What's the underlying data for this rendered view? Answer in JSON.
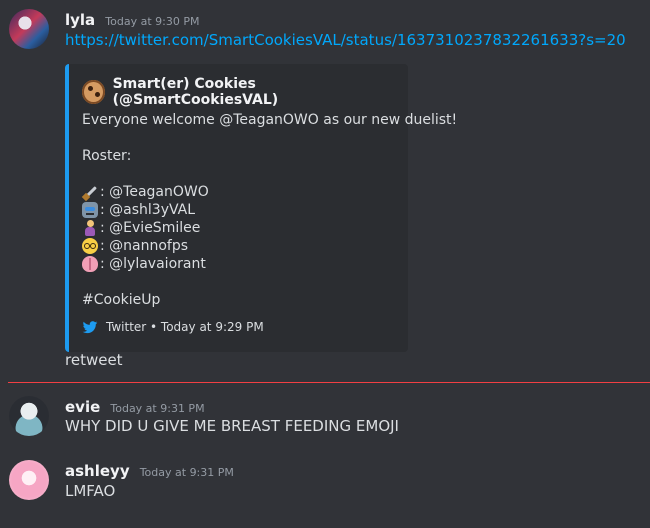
{
  "messages": [
    {
      "username": "lyla",
      "timestamp": "Today at 9:30 PM",
      "link": "https://twitter.com/SmartCookiesVAL/status/1637310237832261633?s=20",
      "embed": {
        "author": "Smart(er) Cookies (@SmartCookiesVAL)",
        "line1": "Everyone welcome @TeaganOWO as our new duelist!",
        "roster_heading": "Roster:",
        "roster": [
          {
            "icon": "dagger-emoji",
            "text": ": @TeaganOWO"
          },
          {
            "icon": "robot-emoji",
            "text": ": @ashl3yVAL"
          },
          {
            "icon": "breastfeeding-emoji",
            "text": ": @EvieSmilee"
          },
          {
            "icon": "nerd-face-emoji",
            "text": ": @nannofps"
          },
          {
            "icon": "brain-emoji",
            "text": ": @lylavaiorant"
          }
        ],
        "hashtag": "#CookieUp",
        "footer": "Twitter • Today at 9:29 PM",
        "accent_color": "#1d9bf0"
      },
      "follow_text": "retweet"
    },
    {
      "username": "evie",
      "timestamp": "Today at 9:31 PM",
      "text": "WHY DID U GIVE ME BREAST FEEDING EMOJI"
    },
    {
      "username": "ashleyy",
      "timestamp": "Today at 9:31 PM",
      "text": "LMFAO"
    }
  ],
  "colors": {
    "background": "#313338",
    "link": "#00a8fc",
    "new_messages_divider": "#f23f43"
  }
}
